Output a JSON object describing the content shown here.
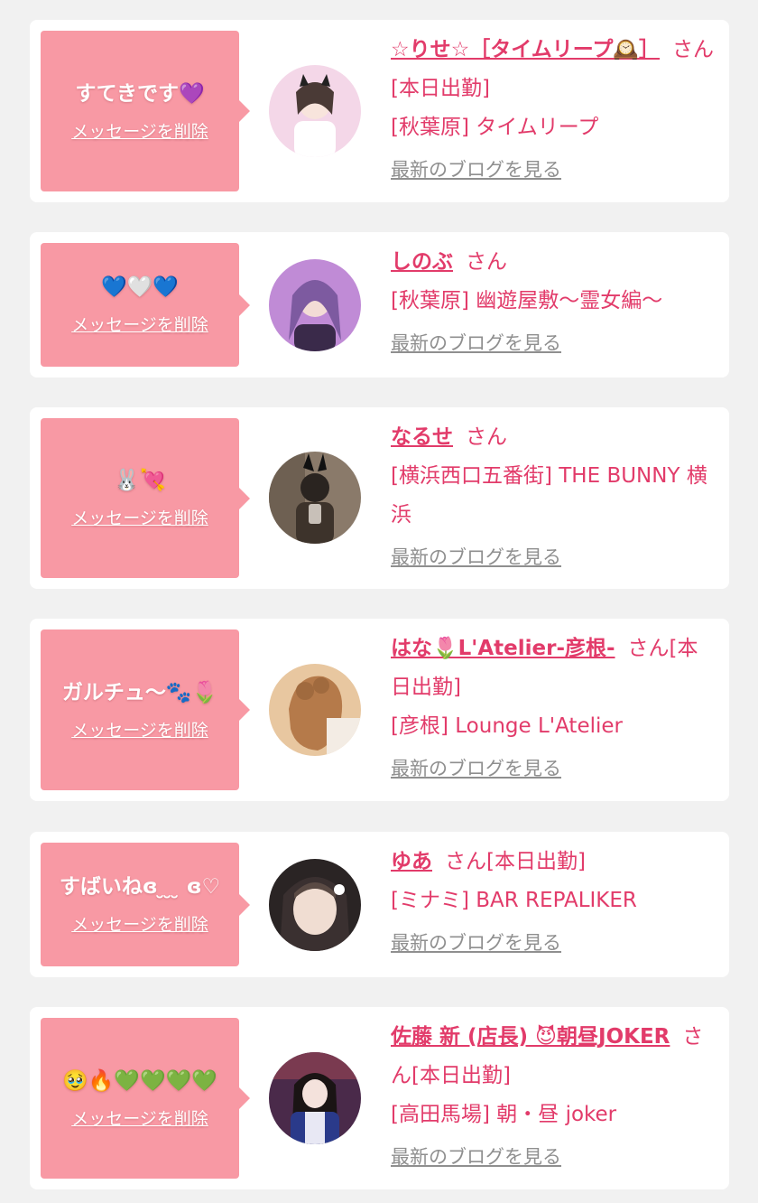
{
  "actions": {
    "delete_label": "メッセージを削除",
    "blog_label": "最新のブログを見る"
  },
  "suffix": "さん",
  "entries": [
    {
      "message": "すてきです💜",
      "name": "☆りせ☆［タイムリープ🕰️］",
      "status": "[本日出勤]",
      "shop": "[秋葉原] タイムリープ",
      "avatar_colors": [
        "#f4d7e8",
        "#d9b3cf"
      ]
    },
    {
      "message": "💙🤍💙",
      "name": "しのぶ",
      "status": "",
      "shop": "[秋葉原] 幽遊屋敷～霊女編～",
      "avatar_colors": [
        "#c08bd6",
        "#6b3d86"
      ]
    },
    {
      "message": "🐰💘",
      "name": "なるせ",
      "status": "",
      "shop": "[横浜西口五番街] THE BUNNY 横浜",
      "avatar_colors": [
        "#8a7a6a",
        "#3d332b"
      ]
    },
    {
      "message": "ガルチュ～🐾🌷",
      "name": "はな🌷L'Atelier-彦根-",
      "status": "[本日出勤]",
      "shop": "[彦根] Lounge L'Atelier",
      "avatar_colors": [
        "#e8c7a0",
        "#b57a4a"
      ]
    },
    {
      "message": "すばいねɞ ̮ ̮ ̮ ɞ♡",
      "name": "ゆあ",
      "status": "[本日出勤]",
      "shop": "[ミナミ] BAR REPALIKER",
      "avatar_colors": [
        "#e6d8d0",
        "#2a2424"
      ]
    },
    {
      "message": "🥹🔥💚💚💚💚",
      "name": "佐藤 新 (店長) 😈朝昼JOKER",
      "status": "[本日出勤]",
      "shop": "[高田馬場] 朝・昼 joker",
      "avatar_colors": [
        "#4a2a4a",
        "#2a3a8a"
      ]
    }
  ]
}
